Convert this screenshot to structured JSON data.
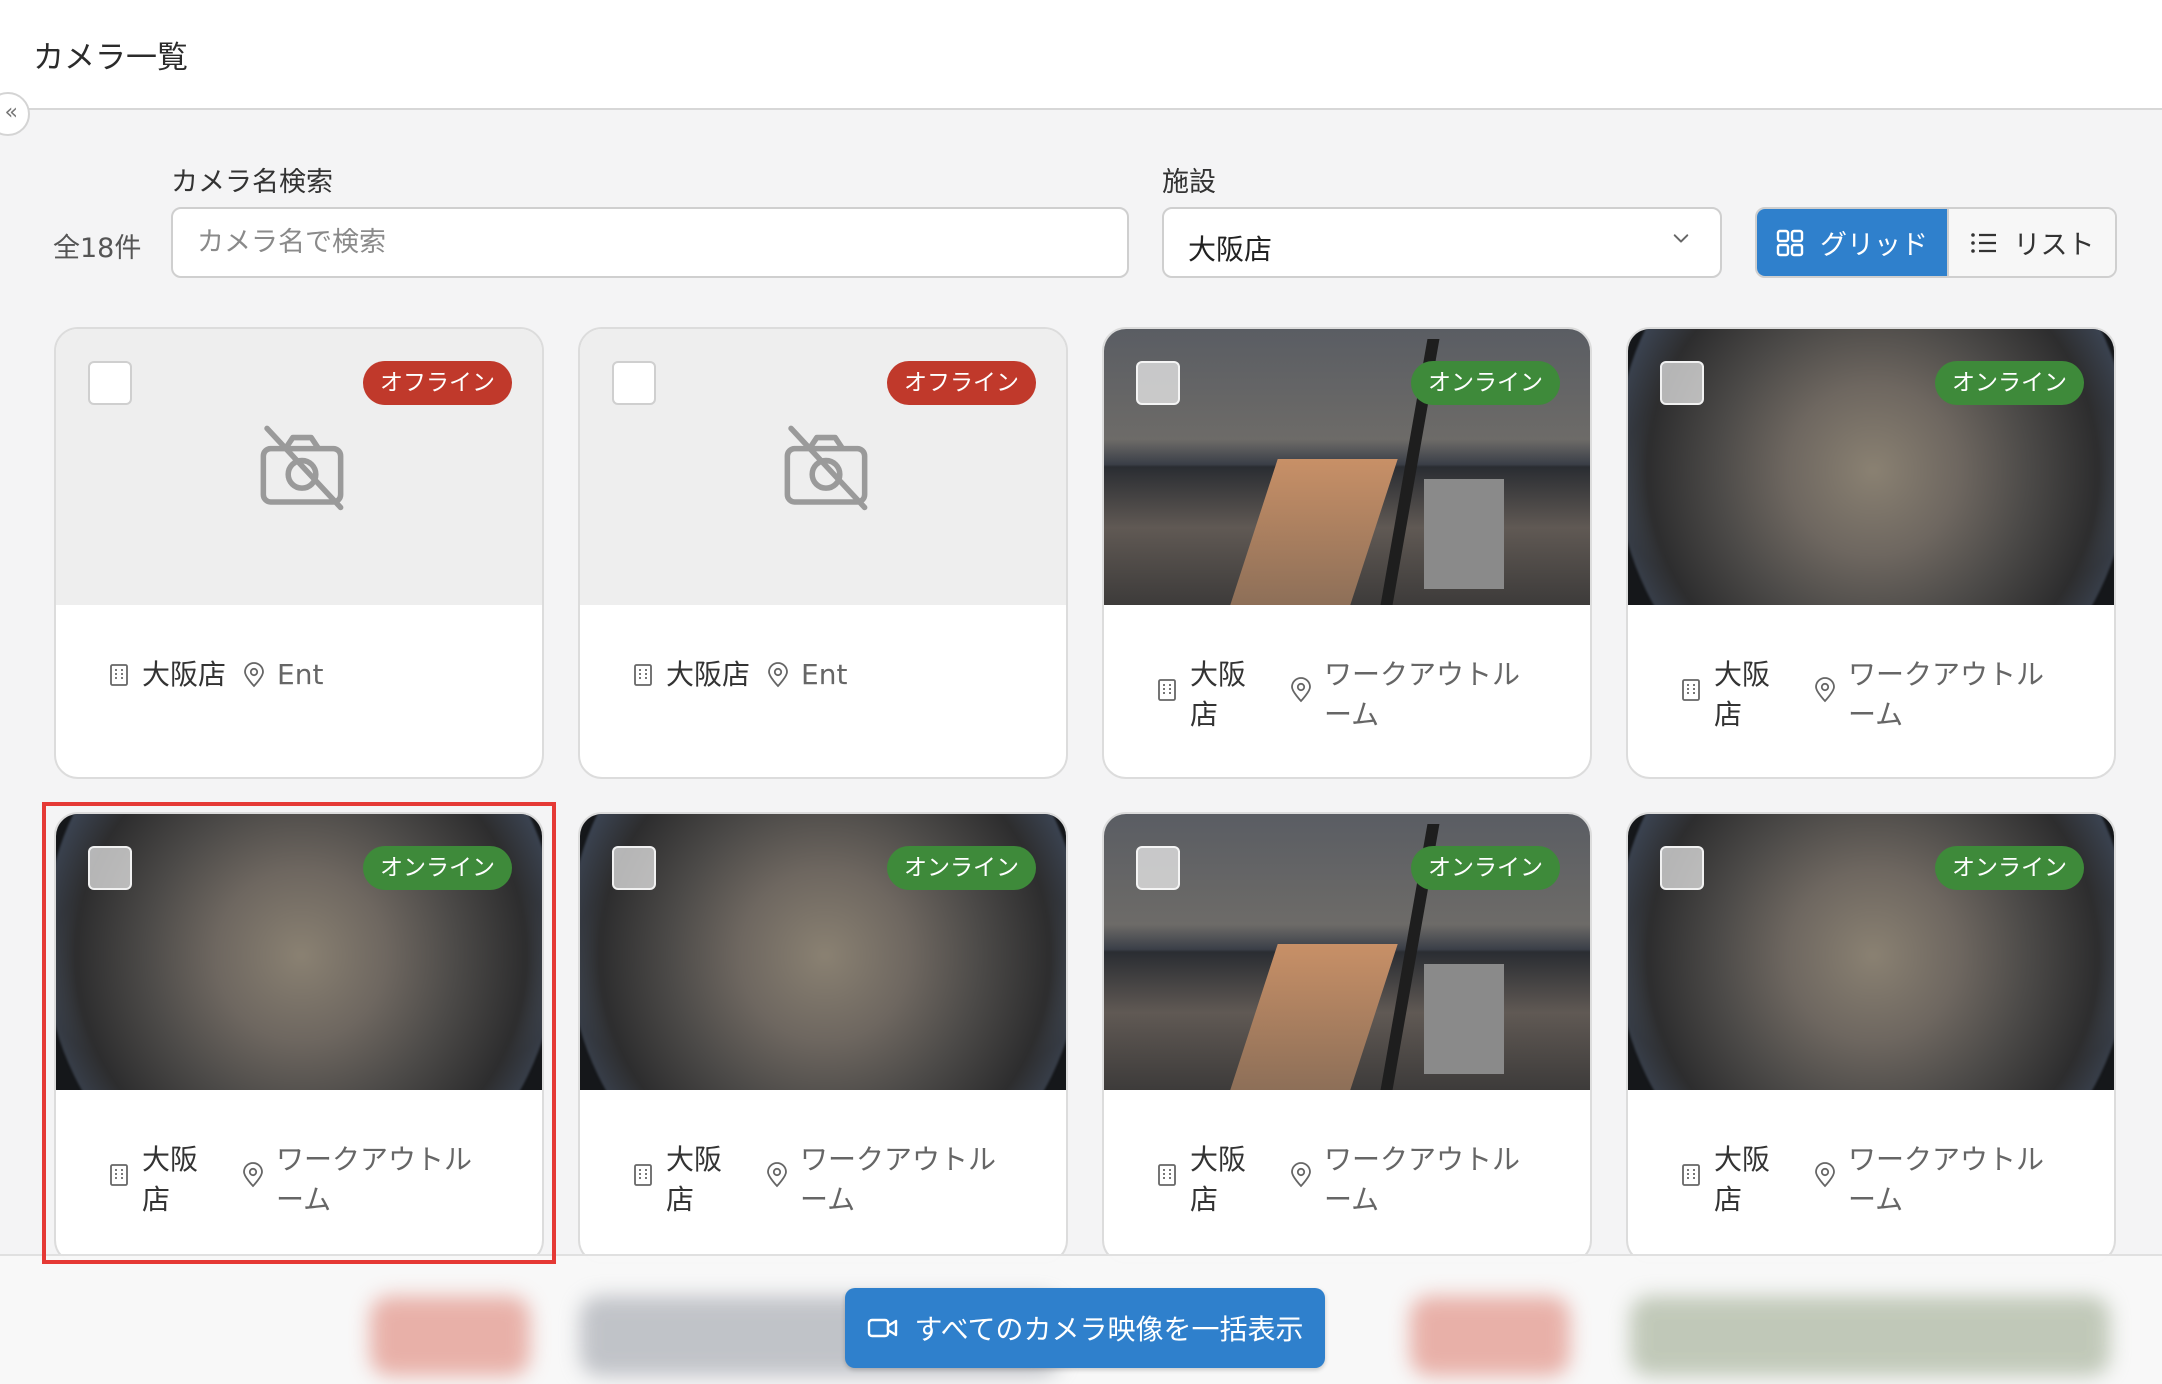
{
  "header": {
    "title": "カメラ一覧",
    "collapse_icon": "«"
  },
  "filters": {
    "count": "全18件",
    "search_label": "カメラ名検索",
    "search_placeholder": "カメラ名で検索",
    "search_value": "",
    "facility_label": "施設",
    "facility_value": "大阪店"
  },
  "view_toggle": {
    "grid": "グリッド",
    "list": "リスト",
    "active": "grid"
  },
  "cards": [
    {
      "status": "オフライン",
      "facility": "大阪店",
      "location": "Ent"
    },
    {
      "status": "オフライン",
      "facility": "大阪店",
      "location": "Ent"
    },
    {
      "status": "オンライン",
      "facility": "大阪店",
      "location": "ワークアウトルーム"
    },
    {
      "status": "オンライン",
      "facility": "大阪店",
      "location": "ワークアウトルーム"
    },
    {
      "status": "オンライン",
      "facility": "大阪店",
      "location": "ワークアウトルーム"
    },
    {
      "status": "オンライン",
      "facility": "大阪店",
      "location": "ワークアウトルーム"
    },
    {
      "status": "オンライン",
      "facility": "大阪店",
      "location": "ワークアウトルーム"
    },
    {
      "status": "オンライン",
      "facility": "大阪店",
      "location": "ワークアウトルーム"
    }
  ],
  "bulk_button": {
    "label": "すべてのカメラ映像を一括表示"
  },
  "colors": {
    "primary": "#2f80cc",
    "offline_badge": "#c0392b",
    "online_badge": "#3e8a3a",
    "highlight": "#e53935"
  }
}
